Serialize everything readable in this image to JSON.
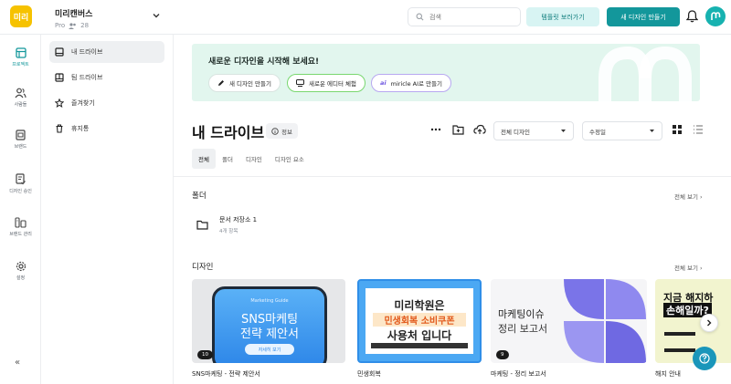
{
  "header": {
    "logo_text": "미리",
    "workspace_name": "미리캔버스",
    "plan": "Pro",
    "member_count": "28",
    "search_placeholder": "검색",
    "template_button": "템플릿 보러가기",
    "new_design_button": "새 디자인 만들기"
  },
  "rail": {
    "items": [
      {
        "label": "프로젝트",
        "icon": "project-icon"
      },
      {
        "label": "사람들",
        "icon": "people-icon"
      },
      {
        "label": "브랜드",
        "icon": "brand-icon"
      },
      {
        "label": "디자인 승인",
        "icon": "approval-icon"
      },
      {
        "label": "브랜드 관리",
        "icon": "brand-manage-icon"
      },
      {
        "label": "설정",
        "icon": "gear-icon"
      }
    ],
    "collapse": "«"
  },
  "sidebar": {
    "items": [
      {
        "label": "내 드라이브",
        "icon": "drive-icon"
      },
      {
        "label": "팀 드라이브",
        "icon": "team-drive-icon"
      },
      {
        "label": "즐겨찾기",
        "icon": "star-icon"
      },
      {
        "label": "휴지통",
        "icon": "trash-icon"
      }
    ]
  },
  "banner": {
    "title": "새로운 디자인을 시작해 보세요!",
    "buttons": [
      "새 디자인 만들기",
      "새로운 에디터 체험",
      "miricle AI로 만들기"
    ],
    "ai_brand": "ai"
  },
  "drive": {
    "title": "내 드라이브",
    "info_label": "정보",
    "filter_select": "전체 디자인",
    "sort_select": "수정일",
    "tabs": [
      "전체",
      "폴더",
      "디자인",
      "디자인 요소"
    ]
  },
  "folders": {
    "title": "폴더",
    "see_all": "전체 보기 ›",
    "items": [
      {
        "name": "문서 저장소 1",
        "count": "4개 항목"
      }
    ]
  },
  "designs": {
    "title": "디자인",
    "see_all": "전체 보기 ›",
    "items": [
      {
        "name": "SNS마케팅 - 전략 제안서",
        "pages": "10",
        "thumb_tag": "Marketing Guide",
        "thumb_line1": "SNS마케팅",
        "thumb_line2": "전략 제안서",
        "thumb_button": "자세히 보기"
      },
      {
        "name": "민생회복",
        "pages": "",
        "thumb_line1": "미리학원은",
        "thumb_line2": "민생회복 소비쿠폰",
        "thumb_line3": "사용처 입니다"
      },
      {
        "name": "마케팅 - 정리 보고서",
        "pages": "9",
        "thumb_line1": "마케팅이슈",
        "thumb_line2": "정리 보고서"
      },
      {
        "name": "해지 안내",
        "pages": "",
        "thumb_line1": "지금 해지하",
        "thumb_line2": "손해일까?"
      }
    ]
  },
  "colors": {
    "accent": "#13979b",
    "accent_light": "#d8f4f3",
    "banner_bg": "#e2f6ee",
    "logo": "#f6c200",
    "help": "#1a96ba"
  }
}
